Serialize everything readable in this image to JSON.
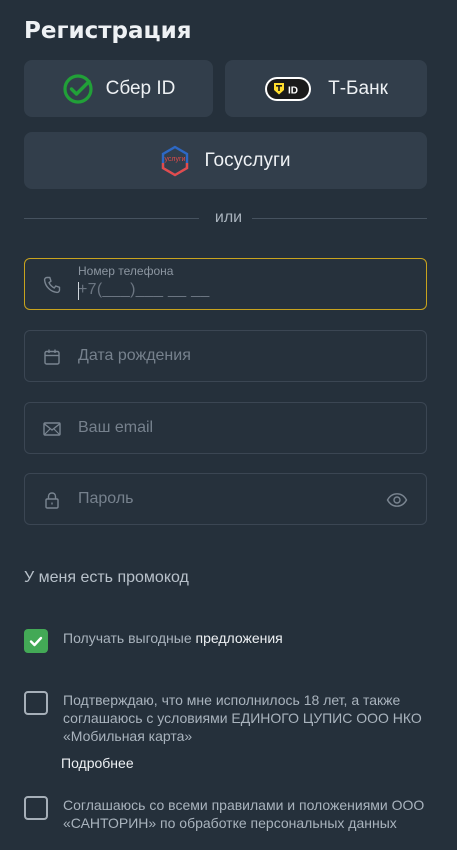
{
  "title": "Регистрация",
  "auth_buttons": {
    "sber": "Сбер ID",
    "tbank": "Т-Банк",
    "tbank_badge": "ID",
    "gosuslugi": "Госуслуги",
    "gosuslugi_logo_text": "услуги"
  },
  "divider": "или",
  "fields": {
    "phone": {
      "label": "Номер телефона",
      "mask": "+7(___)___ __ __"
    },
    "birthdate": {
      "placeholder": "Дата рождения"
    },
    "email": {
      "placeholder": "Ваш email"
    },
    "password": {
      "placeholder": "Пароль"
    }
  },
  "promo": "У меня есть промокод",
  "consents": {
    "offers_part1": "Получать выгодные ",
    "offers_part2": "предложения",
    "age": "Подтверждаю, что мне исполнилось 18 лет, а также соглашаюсь с условиями ЕДИНОГО ЦУПИС ООО НКО «Мобильная карта»",
    "more": "Подробнее",
    "rules": "Соглашаюсь со всеми правилами и положениями ООО «САНТОРИН» по обработке персональных данных"
  },
  "colors": {
    "background": "#25303b",
    "button": "#323e4b",
    "active_border": "#c8a31e",
    "checkbox_checked": "#43a956",
    "sber_green": "#21a038",
    "tbank_yellow": "#ffdd2d"
  }
}
